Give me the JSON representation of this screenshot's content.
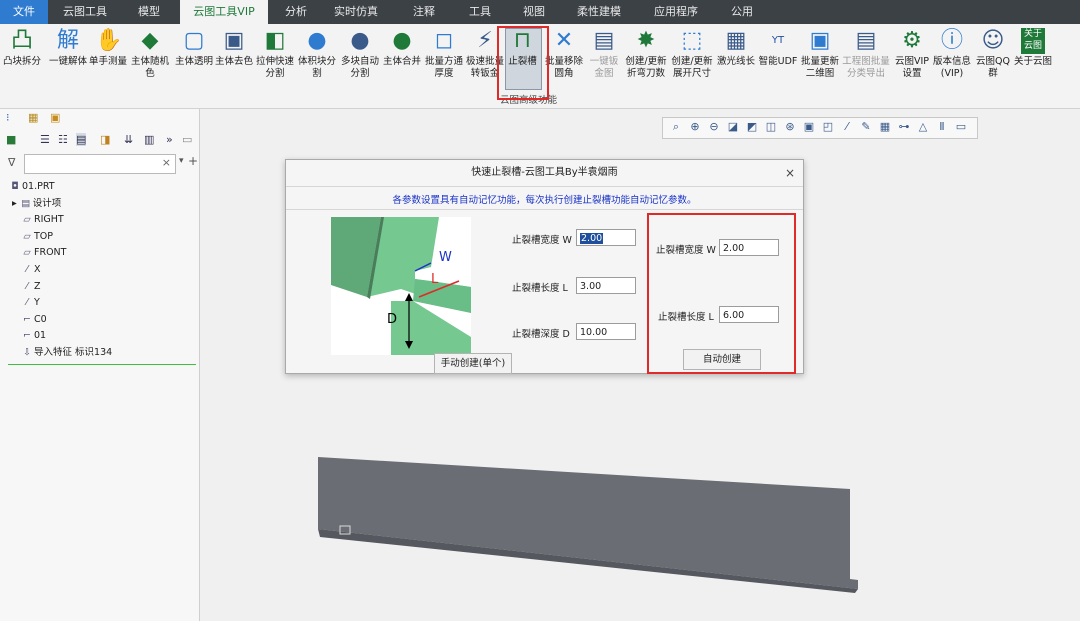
{
  "menu_tabs": [
    "文件",
    "云图工具",
    "模型",
    "云图工具VIP",
    "分析",
    "实时仿真",
    "注释",
    "工具",
    "视图",
    "柔性建模",
    "应用程序",
    "公用"
  ],
  "ribbon": {
    "items": [
      {
        "label": "凸块拆分",
        "icon": "convex-split-icon",
        "glyph": "凸"
      },
      {
        "label": "一键解体",
        "icon": "dissolve-icon",
        "glyph": "解"
      },
      {
        "label": "单手测量",
        "icon": "measure-icon",
        "glyph": "✋"
      },
      {
        "label": "主体随机色",
        "icon": "random-color-icon",
        "glyph": "◆"
      },
      {
        "label": "主体透明",
        "icon": "transparent-icon",
        "glyph": "▢"
      },
      {
        "label": "主体去色",
        "icon": "decolor-icon",
        "glyph": "▣"
      },
      {
        "label": "拉伸快速分割",
        "icon": "extrude-split-icon",
        "glyph": "◧"
      },
      {
        "label": "体积块分割",
        "icon": "volume-split-icon",
        "glyph": "●"
      },
      {
        "label": "多块自动分割",
        "icon": "multi-split-icon",
        "glyph": "●"
      },
      {
        "label": "主体合并",
        "icon": "merge-icon",
        "glyph": "●"
      },
      {
        "label": "批量方通厚度",
        "icon": "batch-thickness-icon",
        "glyph": "◻"
      },
      {
        "label": "极速批量转钣金",
        "icon": "sheetmetal-convert-icon",
        "glyph": "⚡"
      },
      {
        "label": "止裂槽",
        "icon": "relief-slot-icon",
        "glyph": "⊓"
      },
      {
        "label": "批量移除圆角",
        "icon": "remove-round-icon",
        "glyph": "✕"
      },
      {
        "label": "一键钣金图",
        "icon": "sheetmetal-drawing-icon",
        "glyph": "▤"
      },
      {
        "label": "创建/更新折弯刀数",
        "icon": "bend-count-icon",
        "glyph": "✸"
      },
      {
        "label": "创建/更新展开尺寸",
        "icon": "flat-size-icon",
        "glyph": "⬚"
      },
      {
        "label": "激光线长",
        "icon": "laser-length-icon",
        "glyph": "▦"
      },
      {
        "label": "智能UDF",
        "icon": "udf-icon",
        "glyph": "YT"
      },
      {
        "label": "批量更新二维图",
        "icon": "update-2d-icon",
        "glyph": "▣"
      },
      {
        "label": "工程图批量分类导出",
        "icon": "batch-export-icon",
        "glyph": "▤"
      },
      {
        "label": "云图VIP设置",
        "icon": "gear-icon",
        "glyph": "⚙"
      },
      {
        "label": "版本信息(VIP)",
        "icon": "info-icon",
        "glyph": "ⓘ"
      },
      {
        "label": "云图QQ群",
        "icon": "qq-icon",
        "glyph": "☺"
      },
      {
        "label": "关于云图",
        "icon": "about-icon",
        "glyph": "关于云图"
      }
    ],
    "group_label": "云图高级功能"
  },
  "left_panel": {
    "filter_placeholder": "",
    "tree": [
      {
        "label": "01.PRT",
        "icon": "part-icon",
        "glyph": "◘"
      },
      {
        "label": "设计项",
        "icon": "design-items-icon",
        "glyph": "▤"
      },
      {
        "label": "RIGHT",
        "icon": "datum-plane-icon",
        "glyph": "▱"
      },
      {
        "label": "TOP",
        "icon": "datum-plane-icon",
        "glyph": "▱"
      },
      {
        "label": "FRONT",
        "icon": "datum-plane-icon",
        "glyph": "▱"
      },
      {
        "label": "X",
        "icon": "datum-axis-icon",
        "glyph": "⁄"
      },
      {
        "label": "Z",
        "icon": "datum-axis-icon",
        "glyph": "⁄"
      },
      {
        "label": "Y",
        "icon": "datum-axis-icon",
        "glyph": "⁄"
      },
      {
        "label": "C0",
        "icon": "coord-sys-icon",
        "glyph": "⌐"
      },
      {
        "label": "01",
        "icon": "coord-sys-icon",
        "glyph": "⌐"
      },
      {
        "label": "导入特征 标识134",
        "icon": "import-feature-icon",
        "glyph": "⇩"
      }
    ]
  },
  "dialog": {
    "title": "快速止裂槽-云图工具By半袁烟雨",
    "close": "×",
    "note": "各参数设置具有自动记忆功能，每次执行创建止裂槽功能自动记忆参数。",
    "diagram": {
      "w": "W",
      "l": "L",
      "d": "D"
    },
    "manual": {
      "width_label": "止裂槽宽度 W",
      "width_value": "2.00",
      "length_label": "止裂槽长度 L",
      "length_value": "3.00",
      "depth_label": "止裂槽深度 D",
      "depth_value": "10.00",
      "button": "手动创建(单个)"
    },
    "auto": {
      "width_label": "止裂槽宽度 W",
      "width_value": "2.00",
      "length_label": "止裂槽长度 L",
      "length_value": "6.00",
      "button": "自动创建"
    }
  },
  "colors": {
    "highlight": "#e02a2a",
    "note": "#1a33c8",
    "part": "#6a6d73",
    "sheet_green": "#6dc38a"
  }
}
